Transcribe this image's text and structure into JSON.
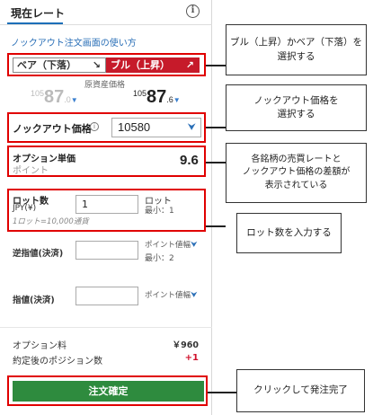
{
  "header": {
    "title": "現在レート",
    "info_icon": "info-icon"
  },
  "howto_link": "ノックアウト注文画面の使い方",
  "direction": {
    "bear_label": "ベア（下落）",
    "bear_arrow": "↘",
    "bull_label": "ブル（上昇）",
    "bull_arrow": "↗",
    "bull_color": "#c61a2a"
  },
  "underlying": {
    "label": "原資産価格",
    "left_price": {
      "prefix": "105",
      "main": "87",
      "fraction": ".0",
      "arrow": "▼"
    },
    "right_price": {
      "prefix": "105",
      "main": "87",
      "fraction": ".6",
      "arrow": "▼"
    }
  },
  "knockout": {
    "label": "ノックアウト価格",
    "value": "10580",
    "chevron": "chevron-down-icon"
  },
  "option_price": {
    "title": "オプション単価",
    "sub": "ポイント",
    "value": "9.6"
  },
  "lot": {
    "title": "ロット数",
    "currency": "JPY(¥)",
    "note": "1ロット=10,000通貨",
    "value": "1",
    "unit": "ロット",
    "min": "最小：1"
  },
  "stop_order": {
    "label": "逆指値(決済)",
    "unit": "ポイント値幅",
    "min": "最小：2"
  },
  "limit_order": {
    "label": "指値(決済)",
    "unit": "ポイント値幅"
  },
  "summary": {
    "fee_label": "オプション料",
    "fee_value": "￥960",
    "position_label": "約定後のポジション数",
    "position_value": "+1"
  },
  "submit_label": "注文確定",
  "callouts": {
    "direction": "ブル（上昇）かベア（下落）を\n選択する",
    "knockout": "ノックアウト価格を\n選択する",
    "option": "各銘柄の売買レートと\nノックアウト価格の差額が\n表示されている",
    "lot": "ロット数を入力する",
    "submit": "クリックして発注完了"
  },
  "colors": {
    "accent": "#1d6fb8",
    "annotation_red": "#e00000",
    "submit_green": "#2e8b3e"
  }
}
